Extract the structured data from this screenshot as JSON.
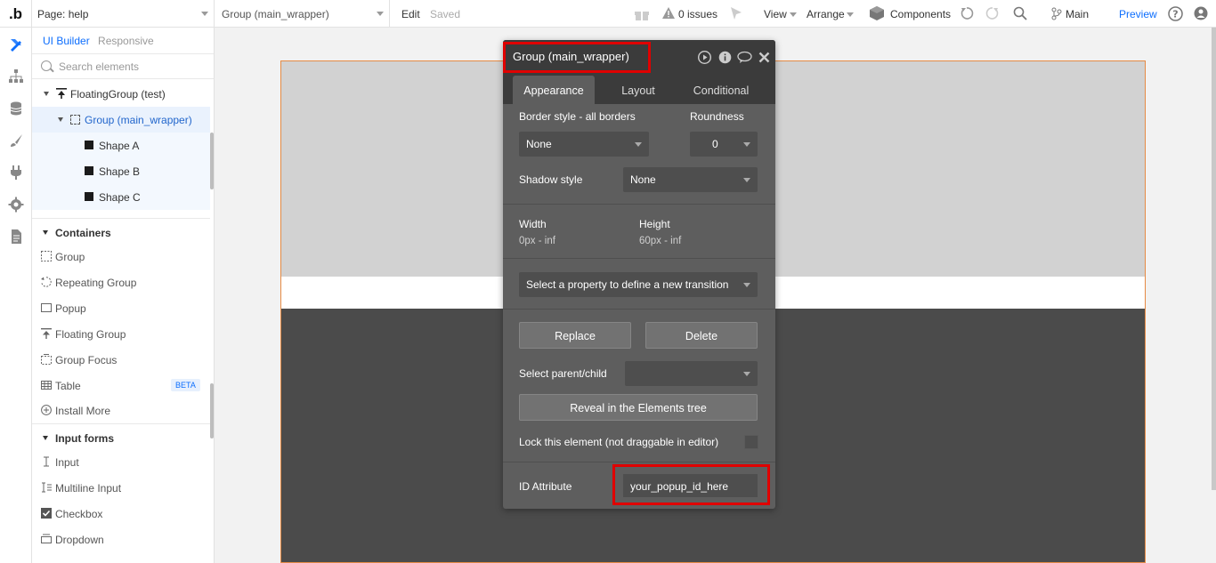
{
  "topbar": {
    "logo": ".b",
    "page_label": "Page: help",
    "element_label": "Group (main_wrapper)",
    "edit": "Edit",
    "saved": "Saved",
    "issues": "0 issues",
    "view": "View",
    "arrange": "Arrange",
    "components": "Components",
    "branch": "Main",
    "preview": "Preview"
  },
  "rail": {
    "icons": [
      "design-icon",
      "sitemap-icon",
      "database-icon",
      "styles-icon",
      "plugins-icon",
      "settings-icon",
      "logs-icon"
    ]
  },
  "panel": {
    "tab_builder": "UI Builder",
    "tab_responsive": "Responsive",
    "search_placeholder": "Search elements",
    "tree": {
      "floating": "FloatingGroup (test)",
      "group": "Group (main_wrapper)",
      "shape_a": "Shape A",
      "shape_b": "Shape B",
      "shape_c": "Shape C"
    },
    "containers": {
      "title": "Containers",
      "items": [
        "Group",
        "Repeating Group",
        "Popup",
        "Floating Group",
        "Group Focus",
        "Table",
        "Install More"
      ],
      "beta": "BETA"
    },
    "inputs": {
      "title": "Input forms",
      "items": [
        "Input",
        "Multiline Input",
        "Checkbox",
        "Dropdown"
      ]
    }
  },
  "editor": {
    "title": "Group (main_wrapper)",
    "tabs": [
      "Appearance",
      "Layout",
      "Conditional"
    ],
    "border_label": "Border style - all borders",
    "roundness_label": "Roundness",
    "border_value": "None",
    "roundness_value": "0",
    "shadow_label": "Shadow style",
    "shadow_value": "None",
    "width_label": "Width",
    "width_value": "0px - inf",
    "height_label": "Height",
    "height_value": "60px - inf",
    "transition_placeholder": "Select a property to define a new transition",
    "replace": "Replace",
    "delete": "Delete",
    "parent_child_label": "Select parent/child",
    "reveal": "Reveal in the Elements tree",
    "lock_label": "Lock this element (not draggable in editor)",
    "id_label": "ID Attribute",
    "id_value": "your_popup_id_here"
  },
  "colors": {
    "accent": "#0d6efd",
    "highlight": "#e00000",
    "frame_border": "#e58a44"
  }
}
